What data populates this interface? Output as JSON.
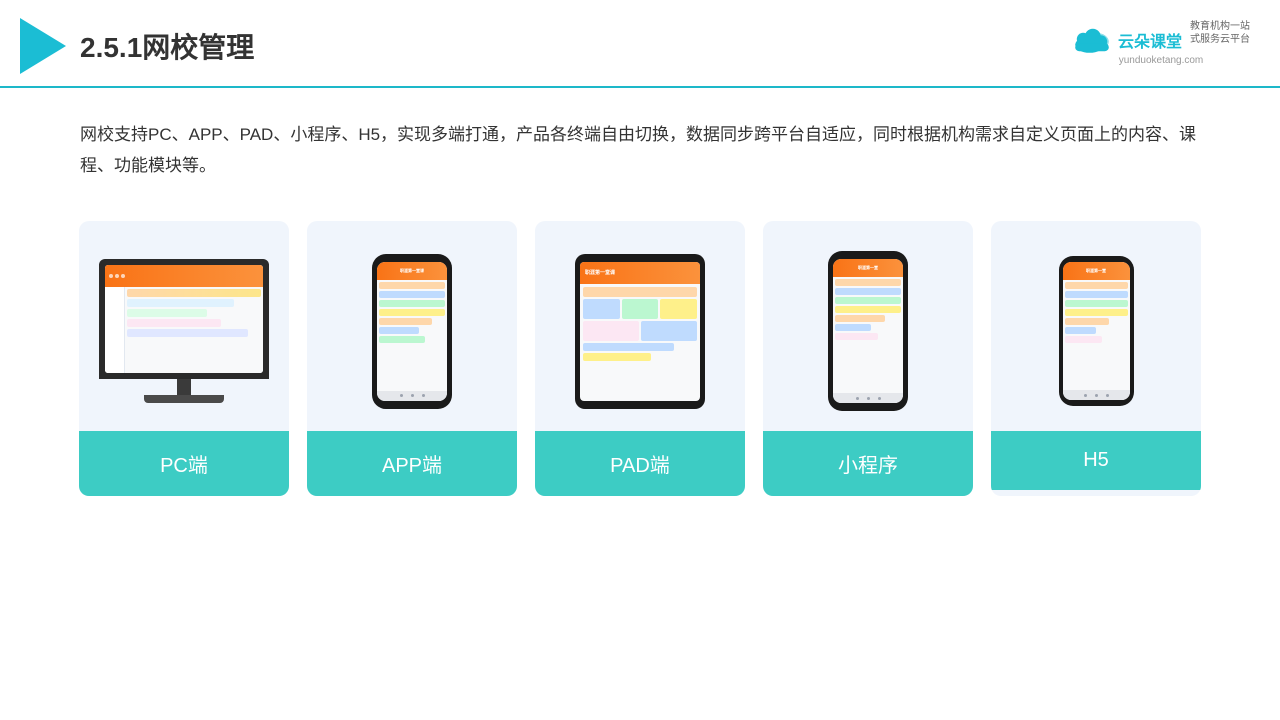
{
  "header": {
    "title": "2.5.1网校管理",
    "brand": {
      "name": "云朵课堂",
      "url": "yunduoketang.com",
      "slogan": "教育机构一站\n式服务云平台"
    }
  },
  "description": "网校支持PC、APP、PAD、小程序、H5，实现多端打通，产品各终端自由切换，数据同步跨平台自适应，同时根据机构需求自定义页面上的内容、课程、功能模块等。",
  "cards": [
    {
      "id": "pc",
      "label": "PC端"
    },
    {
      "id": "app",
      "label": "APP端"
    },
    {
      "id": "pad",
      "label": "PAD端"
    },
    {
      "id": "miniapp",
      "label": "小程序"
    },
    {
      "id": "h5",
      "label": "H5"
    }
  ],
  "colors": {
    "teal": "#3dccc4",
    "accent": "#1bbdd4",
    "border": "#1db8c9"
  }
}
